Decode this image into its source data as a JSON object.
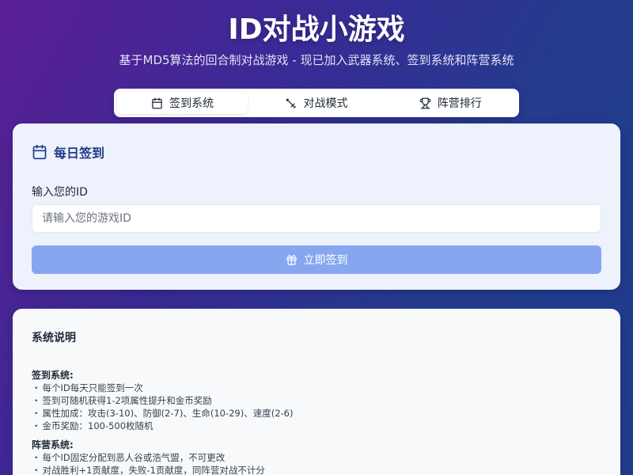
{
  "header": {
    "title": "ID对战小游戏",
    "subtitle": "基于MD5算法的回合制对战游戏 - 现已加入武器系统、签到系统和阵营系统"
  },
  "tabs": [
    {
      "label": "签到系统",
      "icon": "calendar-icon",
      "active": true
    },
    {
      "label": "对战模式",
      "icon": "sword-icon",
      "active": false
    },
    {
      "label": "阵营排行",
      "icon": "trophy-icon",
      "active": false
    }
  ],
  "checkin": {
    "heading": "每日签到",
    "heading_icon": "calendar-icon",
    "field_label": "输入您的ID",
    "placeholder": "请输入您的游戏ID",
    "value": "",
    "button_label": "立即签到",
    "button_icon": "gift-icon"
  },
  "info": {
    "title": "系统说明",
    "sections": [
      {
        "title": "签到系统:",
        "items": [
          "每个ID每天只能签到一次",
          "签到可随机获得1-2项属性提升和金币奖励",
          "属性加成：攻击(3-10)、防御(2-7)、生命(10-29)、速度(2-6)",
          "金币奖励：100-500枚随机"
        ]
      },
      {
        "title": "阵营系统:",
        "items": [
          "每个ID固定分配到恶人谷或浩气盟，不可更改",
          "对战胜利+1贡献度，失败-1贡献度，同阵营对战不计分"
        ]
      }
    ]
  },
  "colors": {
    "accent": "#1e3a8a",
    "button": "#86a7f0"
  }
}
